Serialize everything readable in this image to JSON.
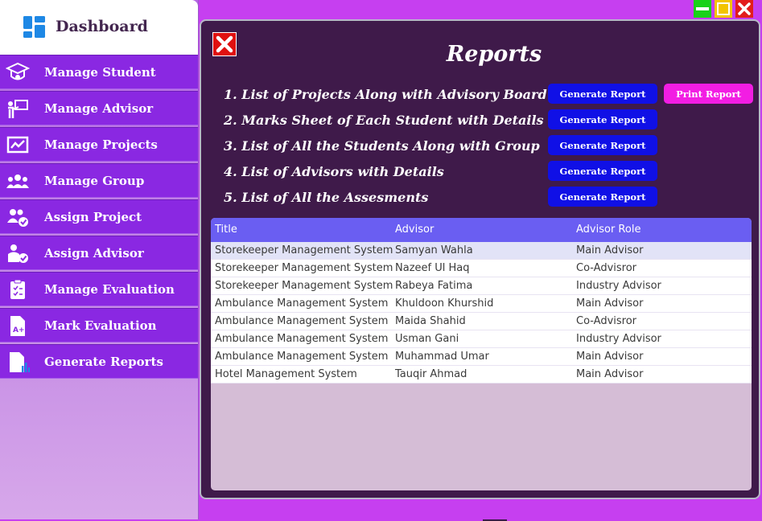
{
  "sidebar": {
    "title": "Dashboard",
    "items": [
      {
        "label": "Manage Student",
        "icon": "graduation-cap-icon"
      },
      {
        "label": "Manage Advisor",
        "icon": "presenter-icon"
      },
      {
        "label": "Manage Projects",
        "icon": "projects-chart-icon"
      },
      {
        "label": "Manage Group",
        "icon": "group-icon"
      },
      {
        "label": "Assign Project",
        "icon": "users-check-icon"
      },
      {
        "label": "Assign Advisor",
        "icon": "user-check-icon"
      },
      {
        "label": "Manage Evaluation",
        "icon": "clipboard-icon"
      },
      {
        "label": "Mark Evaluation",
        "icon": "grade-file-icon"
      },
      {
        "label": "Generate Reports",
        "icon": "report-file-icon"
      }
    ]
  },
  "panel": {
    "title": "Reports",
    "reports": [
      {
        "text": "1. List of Projects Along with Advisory Board",
        "button": "Generate Report"
      },
      {
        "text": "2. Marks Sheet of Each Student with Details",
        "button": "Generate Report"
      },
      {
        "text": "3. List of All the Students Along with Group",
        "button": "Generate Report"
      },
      {
        "text": "4. List of Advisors with Details",
        "button": "Generate Report"
      },
      {
        "text": "5. List of All the Assesments",
        "button": "Generate Report"
      }
    ],
    "print_button": "Print Report"
  },
  "table": {
    "columns": [
      "Title",
      "Advisor",
      "Advisor Role"
    ],
    "rows": [
      [
        "Storekeeper Management System",
        "Samyan Wahla",
        "Main Advisor"
      ],
      [
        "Storekeeper Management System",
        "Nazeef Ul Haq",
        "Co-Advisror"
      ],
      [
        "Storekeeper Management System",
        "Rabeya Fatima",
        "Industry Advisor"
      ],
      [
        "Ambulance Management System",
        "Khuldoon Khurshid",
        "Main Advisor"
      ],
      [
        "Ambulance Management System",
        "Maida Shahid",
        "Co-Advisror"
      ],
      [
        "Ambulance Management System",
        "Usman Gani",
        "Industry Advisor"
      ],
      [
        "Ambulance Management System",
        "Muhammad Umar",
        "Main Advisor"
      ],
      [
        "Hotel Management System",
        "Tauqir Ahmad",
        "Main Advisor"
      ]
    ]
  },
  "colors": {
    "background": "#c63ff0",
    "sidebar_item": "#8a28e2",
    "panel": "#3f1a4a",
    "generate_button": "#1010e6",
    "print_button": "#f21de3",
    "table_header": "#6a5ef2"
  }
}
